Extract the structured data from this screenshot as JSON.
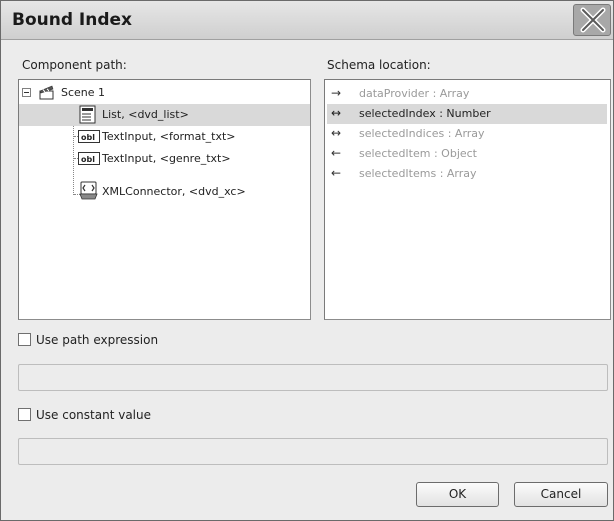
{
  "window": {
    "title": "Bound Index"
  },
  "component_panel": {
    "label": "Component path:",
    "items": [
      {
        "label": "Scene 1",
        "icon": "scene-icon",
        "selected": false
      },
      {
        "label": "List, <dvd_list>",
        "icon": "list-component-icon",
        "selected": true
      },
      {
        "label": "TextInput, <format_txt>",
        "icon": "textinput-component-icon",
        "selected": false
      },
      {
        "label": "TextInput, <genre_txt>",
        "icon": "textinput-component-icon",
        "selected": false
      },
      {
        "label": "XMLConnector, <dvd_xc>",
        "icon": "xmlconnector-component-icon",
        "selected": false
      }
    ]
  },
  "schema_panel": {
    "label": "Schema location:",
    "items": [
      {
        "label": "dataProvider : Array",
        "arrow": "→",
        "enabled": false,
        "selected": false
      },
      {
        "label": "selectedIndex : Number",
        "arrow": "↔",
        "enabled": true,
        "selected": true
      },
      {
        "label": "selectedIndices : Array",
        "arrow": "↔",
        "enabled": false,
        "selected": false
      },
      {
        "label": "selectedItem : Object",
        "arrow": "←",
        "enabled": false,
        "selected": false
      },
      {
        "label": "selectedItems : Array",
        "arrow": "←",
        "enabled": false,
        "selected": false
      }
    ]
  },
  "path_expression": {
    "label": "Use path expression",
    "checked": false,
    "value": ""
  },
  "constant_value": {
    "label": "Use constant value",
    "checked": false,
    "value": ""
  },
  "buttons": {
    "ok": "OK",
    "cancel": "Cancel"
  }
}
